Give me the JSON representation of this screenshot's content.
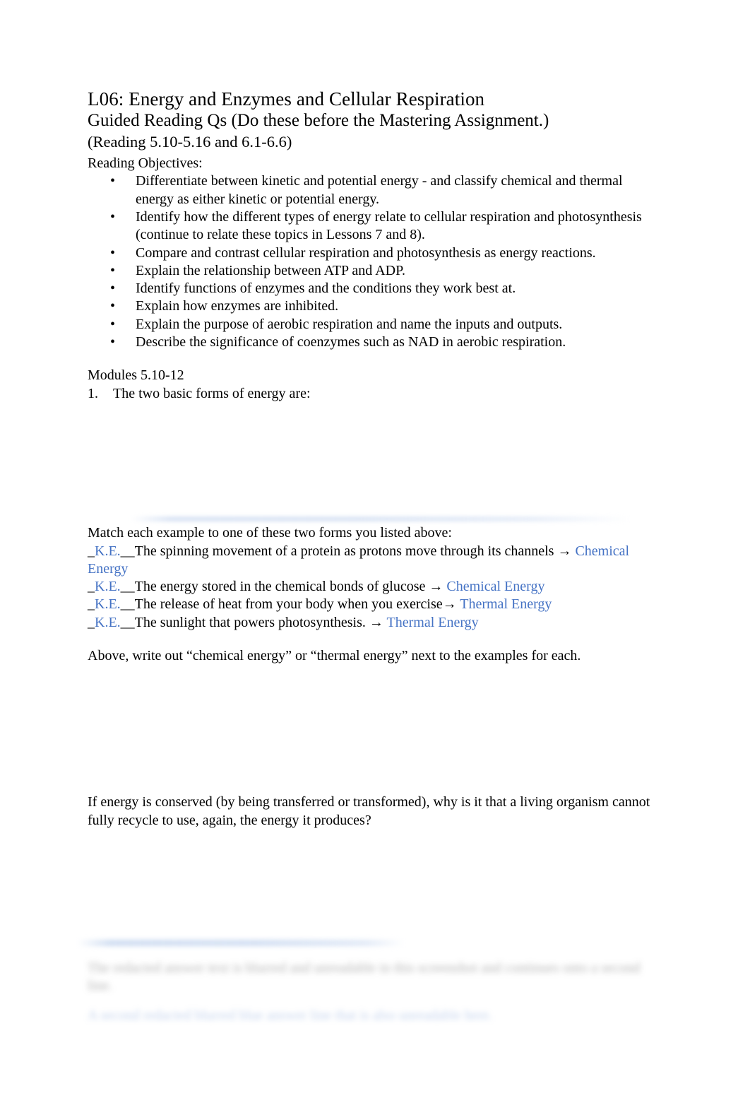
{
  "document": {
    "title": "L06: Energy and Enzymes and Cellular Respiration",
    "subtitle": "Guided Reading Qs (Do these before the Mastering Assignment.)",
    "reading_range": "(Reading 5.10-5.16 and 6.1-6.6)",
    "objectives_label": "Reading Objectives:",
    "bullet_glyph": "•",
    "objectives": [
      "Differentiate between kinetic and potential energy - and classify chemical and thermal energy as either kinetic or potential energy.",
      "Identify how the different types of energy relate to cellular respiration and photosynthesis (continue to relate these topics in Lessons 7 and 8).",
      "Compare and contrast cellular respiration and photosynthesis as energy reactions.",
      "Explain the relationship between ATP and ADP.",
      "Identify functions of enzymes and the conditions they work best at.",
      "Explain how enzymes are inhibited.",
      "Explain the purpose of aerobic respiration and name the inputs and outputs.",
      "Describe the significance of coenzymes such as NAD in aerobic respiration."
    ],
    "modules_heading": "Modules 5.10-12",
    "question_1": {
      "number": "1.",
      "text": "The two basic forms of energy are:"
    },
    "match_intro": "Match each example to one of these two forms you listed above:",
    "match_items": [
      {
        "blank_prefix": "_",
        "answer_blank": "K.E.",
        "blank_suffix": "__",
        "prompt": "The spinning movement of a protein as protons move through its channels ",
        "arrow": "→",
        "classification": "Chemical Energy"
      },
      {
        "blank_prefix": "_",
        "answer_blank": "K.E.",
        "blank_suffix": "__",
        "prompt": "The energy stored in the chemical bonds of glucose ",
        "arrow": "→",
        "classification": "Chemical Energy"
      },
      {
        "blank_prefix": "_",
        "answer_blank": "K.E.",
        "blank_suffix": "__",
        "prompt": "The release of heat from your body when you exercise",
        "arrow": "→",
        "classification": "Thermal Energy"
      },
      {
        "blank_prefix": "_",
        "answer_blank": "K.E.",
        "blank_suffix": "__",
        "prompt": "The sunlight that powers photosynthesis. ",
        "arrow": "→",
        "classification": "Thermal Energy"
      }
    ],
    "write_out_note": "Above, write out “chemical energy” or “thermal energy” next to the examples for each.",
    "conserved_question": "If energy is conserved (by being transferred or transformed), why is it that a living organism cannot fully recycle to use, again, the energy it produces?",
    "redacted": {
      "dark_text": "The redacted answer text is blurred and unreadable in this screenshot and continues onto a second line.",
      "blue_text": "A second redacted blurred blue answer line that is also unreadable here."
    }
  },
  "colors": {
    "page_background": "#ffffff",
    "body_text": "#000000",
    "answer_blue": "#4472c4"
  }
}
